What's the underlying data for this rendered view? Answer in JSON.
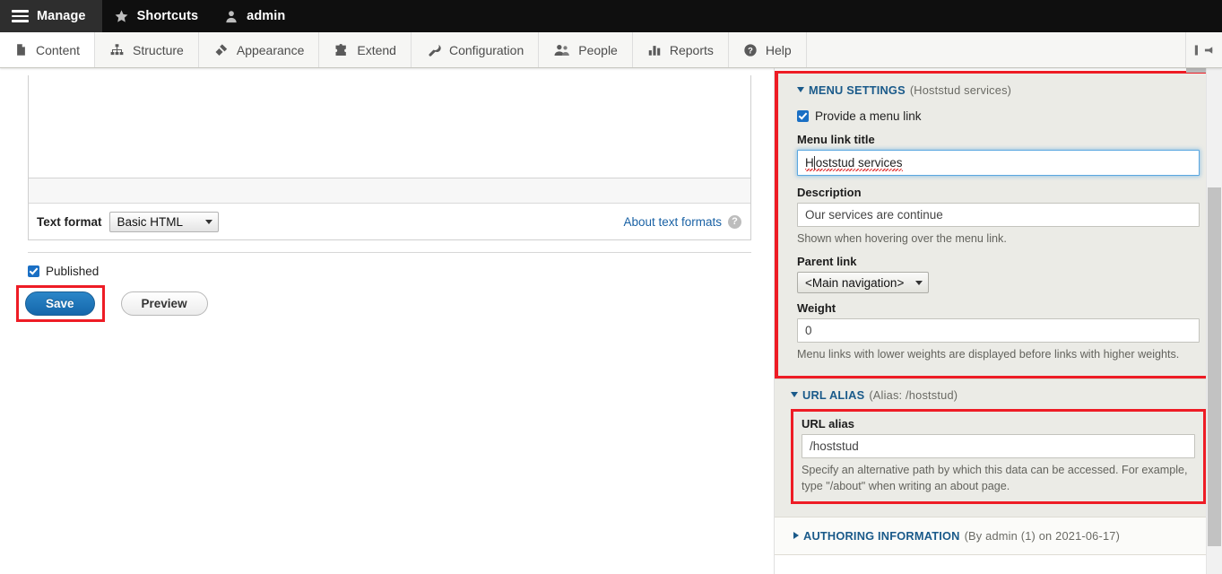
{
  "adminbar": {
    "items": [
      {
        "label": "Manage",
        "icon": "hamburger-icon"
      },
      {
        "label": "Shortcuts",
        "icon": "star-icon"
      },
      {
        "label": "admin",
        "icon": "user-icon"
      }
    ]
  },
  "toolbar": {
    "tabs": [
      {
        "label": "Content",
        "icon": "page-icon",
        "active": true
      },
      {
        "label": "Structure",
        "icon": "sitemap-icon",
        "active": false
      },
      {
        "label": "Appearance",
        "icon": "paintbrush-icon",
        "active": false
      },
      {
        "label": "Extend",
        "icon": "puzzle-icon",
        "active": false
      },
      {
        "label": "Configuration",
        "icon": "wrench-icon",
        "active": false
      },
      {
        "label": "People",
        "icon": "people-icon",
        "active": false
      },
      {
        "label": "Reports",
        "icon": "bars-icon",
        "active": false
      },
      {
        "label": "Help",
        "icon": "question-circle-icon",
        "active": false
      }
    ],
    "collapse_icon": "collapse-left-icon"
  },
  "main": {
    "text_format": {
      "label": "Text format",
      "value": "Basic HTML"
    },
    "about_text_formats": {
      "link": "About text formats",
      "help_icon": "question-mark-icon"
    },
    "published": {
      "label": "Published",
      "checked": true
    },
    "buttons": {
      "save": "Save",
      "preview": "Preview"
    }
  },
  "sidebar": {
    "menu_settings": {
      "title": "MENU SETTINGS",
      "summary": "(Hoststud services)",
      "expanded": true,
      "provide_menu_link": {
        "label": "Provide a menu link",
        "checked": true
      },
      "menu_link_title": {
        "label": "Menu link title",
        "value_prefix": "H",
        "value_rest": "oststud services",
        "value": "Hoststud services",
        "focused": true,
        "misspelled_word": "Hoststud"
      },
      "description": {
        "label": "Description",
        "value": "Our services are continue",
        "help": "Shown when hovering over the menu link."
      },
      "parent_link": {
        "label": "Parent link",
        "value": "<Main navigation>"
      },
      "weight": {
        "label": "Weight",
        "value": "0",
        "help": "Menu links with lower weights are displayed before links with higher weights."
      }
    },
    "url_alias": {
      "title": "URL ALIAS",
      "summary": "(Alias: /hoststud)",
      "expanded": true,
      "field": {
        "label": "URL alias",
        "value": "/hoststud",
        "help": "Specify an alternative path by which this data can be accessed. For example, type \"/about\" when writing an about page."
      }
    },
    "authoring_information": {
      "title": "AUTHORING INFORMATION",
      "summary": "(By admin (1) on 2021-06-17)",
      "expanded": false
    }
  },
  "colors": {
    "highlight": "#ee1c25",
    "accent_blue": "#1567ab",
    "panel_bg": "#ebebe6",
    "heading_blue": "#1a5a8a"
  }
}
